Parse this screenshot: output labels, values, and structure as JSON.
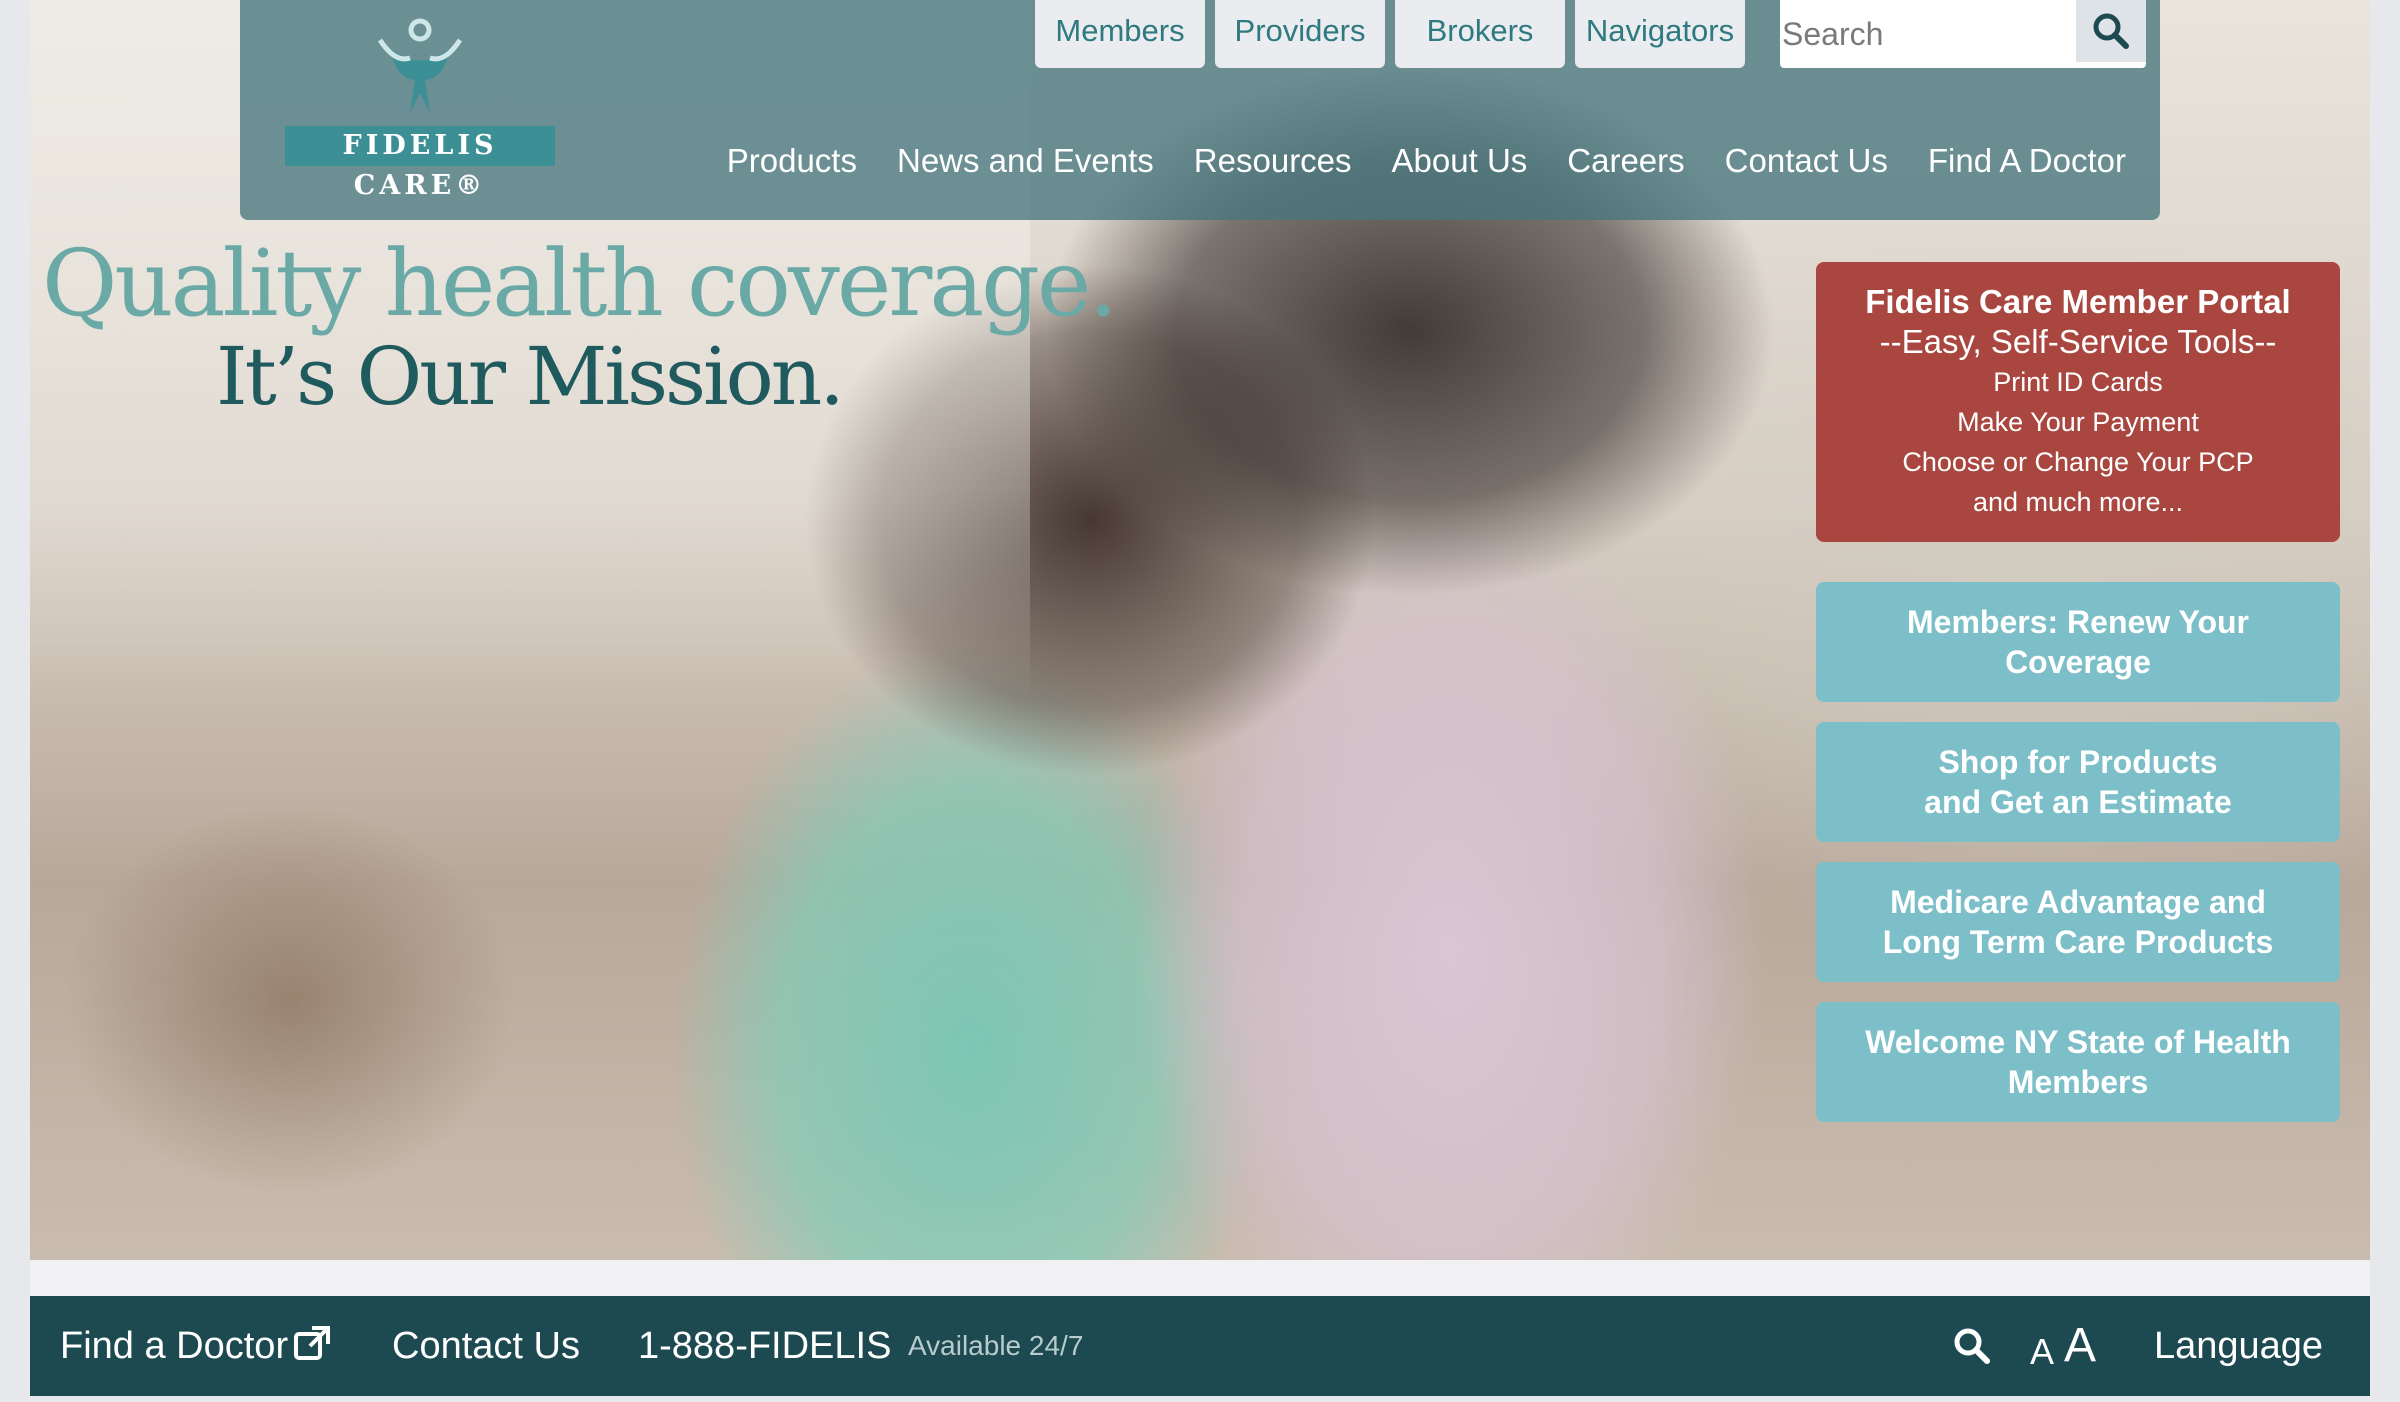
{
  "header": {
    "logo_text": "FIDELIS CARE®",
    "util_tabs": [
      "Members",
      "Providers",
      "Brokers",
      "Navigators"
    ],
    "search": {
      "placeholder": "Search"
    },
    "nav": [
      "Products",
      "News and Events",
      "Resources",
      "About Us",
      "Careers",
      "Contact Us",
      "Find A Doctor"
    ]
  },
  "hero": {
    "tagline_line1": "Quality health coverage.",
    "tagline_line2": "It’s Our Mission."
  },
  "portal": {
    "title": "Fidelis Care Member Portal",
    "subtitle": "--Easy, Self-Service Tools--",
    "items": [
      "Print ID Cards",
      "Make Your Payment",
      "Choose or Change Your PCP",
      "and much more..."
    ]
  },
  "ctas": [
    "Members: Renew Your\nCoverage",
    "Shop for Products\nand Get an Estimate",
    "Medicare Advantage and\nLong Term Care Products",
    "Welcome NY State of Health\nMembers"
  ],
  "footer": {
    "find_doctor": "Find a Doctor",
    "contact_us": "Contact Us",
    "phone": "1-888-FIDELIS",
    "availability": "Available 24/7",
    "text_size_small": "A",
    "text_size_large": "A",
    "language": "Language"
  },
  "colors": {
    "header_band": "#46767e",
    "portal_red": "#a8463f",
    "cta_teal": "#7cbfc8",
    "footer_dark": "#1d4a50"
  }
}
